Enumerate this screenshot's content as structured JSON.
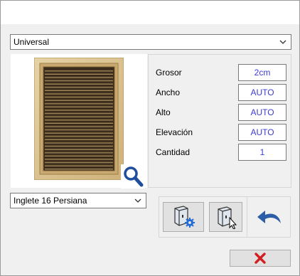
{
  "style_selector": {
    "selected": "Universal"
  },
  "model_selector": {
    "selected": "Inglete 16 Persiana"
  },
  "preview": {
    "image_icon": "louvered-door-icon",
    "zoom_icon": "magnifier-icon"
  },
  "properties": [
    {
      "label": "Grosor",
      "value": "2cm"
    },
    {
      "label": "Ancho",
      "value": "AUTO"
    },
    {
      "label": "Alto",
      "value": "AUTO"
    },
    {
      "label": "Elevación",
      "value": "AUTO"
    },
    {
      "label": "Cantidad",
      "value": "1"
    }
  ],
  "toolbar": {
    "configure_icon": "door-settings-icon",
    "insert_icon": "door-insert-icon",
    "undo_icon": "undo-arrow-icon"
  },
  "dialog": {
    "close_icon": "red-x-icon"
  },
  "colors": {
    "value_text": "#3b3bd6",
    "door_wood": "#dcc38f",
    "zoom_blue": "#1f4f9c",
    "cancel_red": "#d22020"
  }
}
